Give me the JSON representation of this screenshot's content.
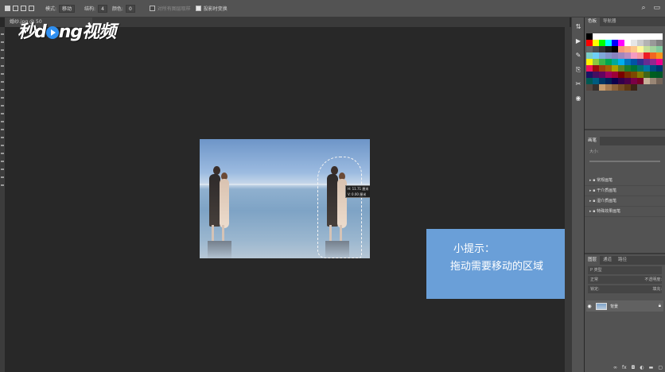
{
  "watermark": {
    "text_left": "秒",
    "text_mid": "d",
    "text_o": "o",
    "text_right": "ng视频"
  },
  "optbar": {
    "mode_label": "模式:",
    "mode_value": "移动",
    "structure_label": "结构:",
    "structure_value": "4",
    "color_label": "颜色:",
    "color_value": "0",
    "sample_all_layers": "对所有图层取样",
    "transform_on_drop": "投影时变换"
  },
  "document": {
    "tab_label": "婚纱.jpg @ 50"
  },
  "tooltip": {
    "line1": "H: 11.71 厘米",
    "line2": "V: 0.00 厘米"
  },
  "tip": {
    "title": "小提示：",
    "body": "拖动需要移动的区域"
  },
  "panels": {
    "swatch_tabs": [
      "色板",
      "导航器"
    ],
    "brush_tab": "画笔",
    "brush_size_label": "大小:",
    "brush_groups": [
      "常规画笔",
      "干介质画笔",
      "湿介质画笔",
      "特殊效果画笔"
    ],
    "layer_tabs": [
      "图层",
      "通道",
      "路径"
    ],
    "layer_filter": "P 类型",
    "blend_mode": "正常",
    "opacity_label": "不透明度:",
    "lock_label": "锁定:",
    "fill_label": "填充:",
    "layer_name": "背景"
  },
  "swatch_colors": [
    "#000000",
    "#ffffff",
    "#ffffff",
    "#ffffff",
    "#ffffff",
    "#ffffff",
    "#ffffff",
    "#ffffff",
    "#ffffff",
    "#ffffff",
    "#ffffff",
    "#ffffff",
    "#ff0000",
    "#ffff00",
    "#00ff00",
    "#00ffff",
    "#0000ff",
    "#ff00ff",
    "#ffffff",
    "#e6e6e6",
    "#cccccc",
    "#b3b3b3",
    "#999999",
    "#808080",
    "#666666",
    "#4d4d4d",
    "#333333",
    "#1a1a1a",
    "#000000",
    "#f7977a",
    "#f9ad81",
    "#fdc68a",
    "#fff79a",
    "#c4df9b",
    "#a2d39c",
    "#82ca9d",
    "#7bcdc8",
    "#6ecff6",
    "#7ea7d8",
    "#8493ca",
    "#8882be",
    "#a187be",
    "#bc8dbf",
    "#f49ac2",
    "#f6989d",
    "#ed1c24",
    "#f26522",
    "#f7941d",
    "#fff200",
    "#8dc73f",
    "#39b54a",
    "#00a651",
    "#00a99d",
    "#00aeef",
    "#0072bc",
    "#0054a6",
    "#2e3192",
    "#662d91",
    "#92278f",
    "#ec008c",
    "#ed145b",
    "#9e0b0f",
    "#a0410d",
    "#a36209",
    "#aba000",
    "#598527",
    "#1a7b30",
    "#007236",
    "#00746b",
    "#0076a3",
    "#004b80",
    "#003471",
    "#1b1464",
    "#440e62",
    "#630460",
    "#9e005d",
    "#9e0039",
    "#790000",
    "#7b2e00",
    "#7d4900",
    "#827b00",
    "#406618",
    "#005e20",
    "#005826",
    "#005952",
    "#005b7f",
    "#003663",
    "#002157",
    "#0d004c",
    "#32004b",
    "#4b0049",
    "#7b0046",
    "#7a0026",
    "#c7b299",
    "#998675",
    "#736357",
    "#534741",
    "#37302d",
    "#c69c6d",
    "#a67c52",
    "#8c6239",
    "#754c24",
    "#603913",
    "#3c2415"
  ]
}
